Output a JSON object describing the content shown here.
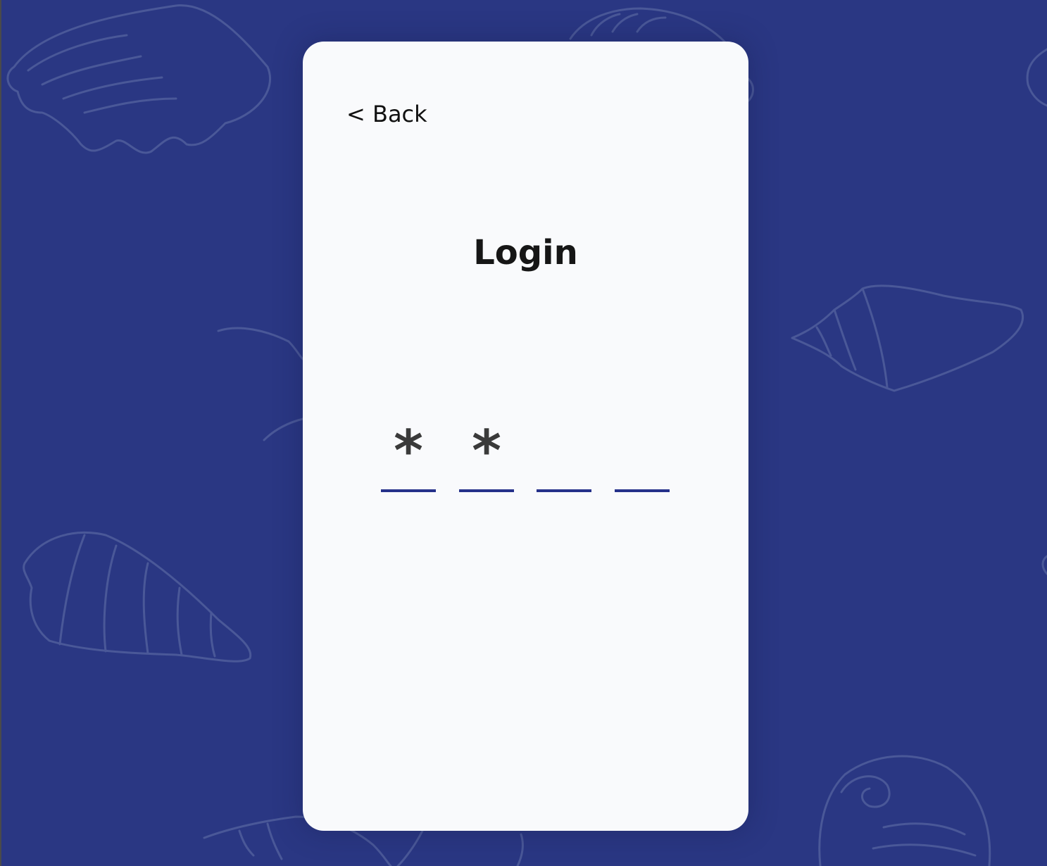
{
  "colors": {
    "background": "#2a3783",
    "card": "#f9fafc",
    "accent": "#25318a",
    "text": "#161616"
  },
  "background_decoration": "seashell-pattern",
  "nav": {
    "back_label": "< Back"
  },
  "page": {
    "title": "Login"
  },
  "pin": {
    "length": 4,
    "entered_count": 2,
    "digits": [
      "*",
      "*",
      "",
      ""
    ]
  }
}
